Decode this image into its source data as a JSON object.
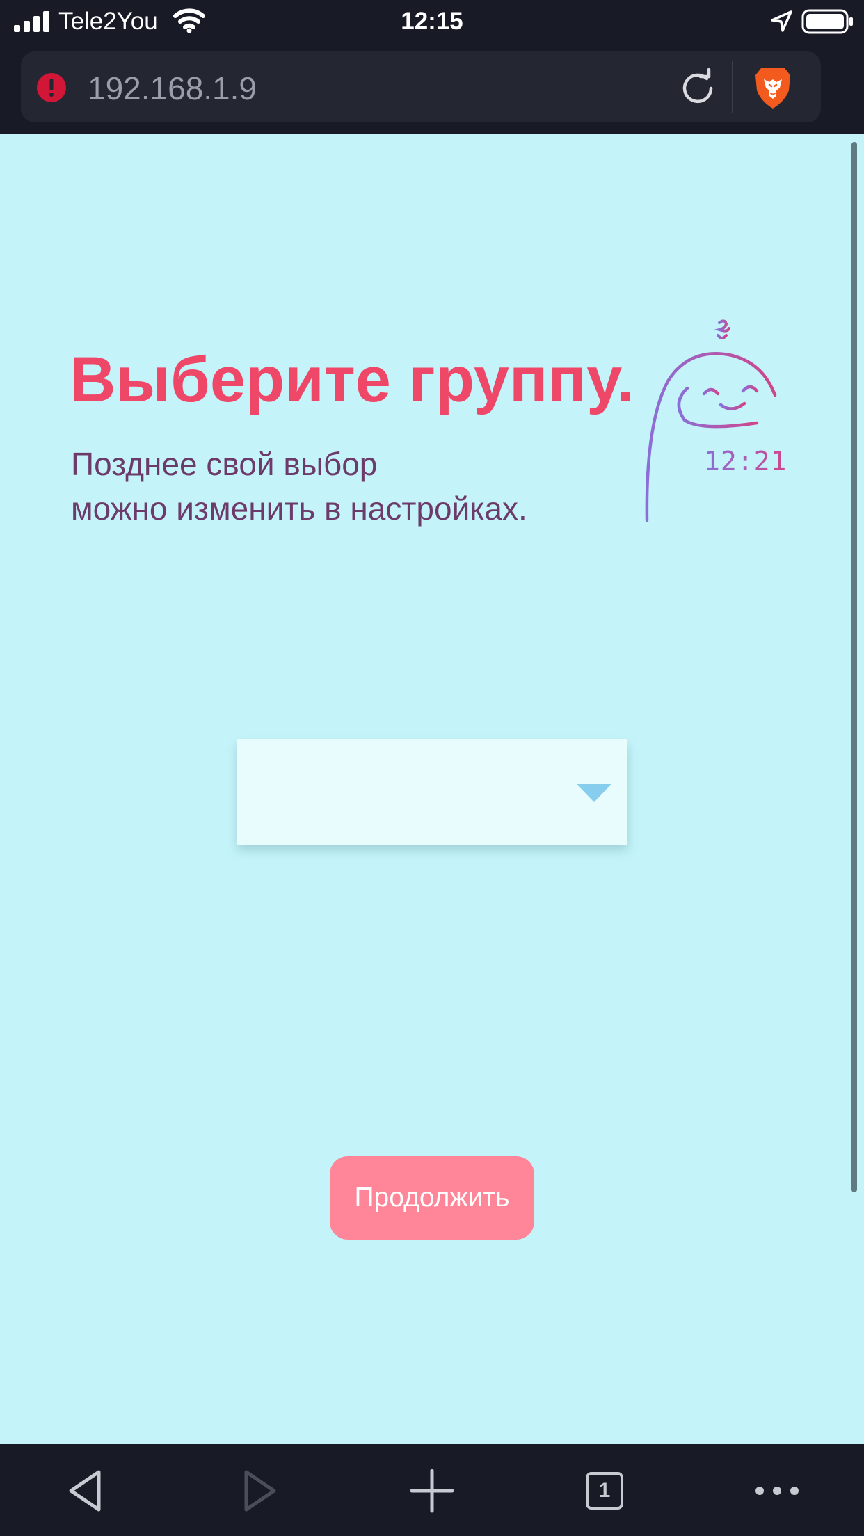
{
  "status_bar": {
    "carrier": "Tele2You",
    "time": "12:15",
    "icons": [
      "signal-icon",
      "wifi-icon",
      "location-arrow-icon",
      "battery-icon"
    ]
  },
  "browser": {
    "url": "192.168.1.9",
    "security_icon": "alert-icon",
    "reload_icon": "reload-icon",
    "shield_icon": "brave-lion-icon",
    "tab_count": "1",
    "toolbar_icons": [
      "back-icon",
      "forward-icon",
      "plus-icon",
      "tabs-icon",
      "more-icon"
    ]
  },
  "page": {
    "title": "Выберите группу.",
    "subtitle_line1": "Позднее свой выбор",
    "subtitle_line2": "можно изменить в настройках.",
    "logo_text": "12:21",
    "group_select": {
      "value": ""
    },
    "continue_label": "Продолжить"
  },
  "colors": {
    "background": "#c4f4fa",
    "title": "#ef4768",
    "subtitle": "#6d3b6a",
    "button": "#ff8699",
    "select": "#e8fbfd",
    "arrow": "#87ceee",
    "chrome": "#181a25"
  }
}
